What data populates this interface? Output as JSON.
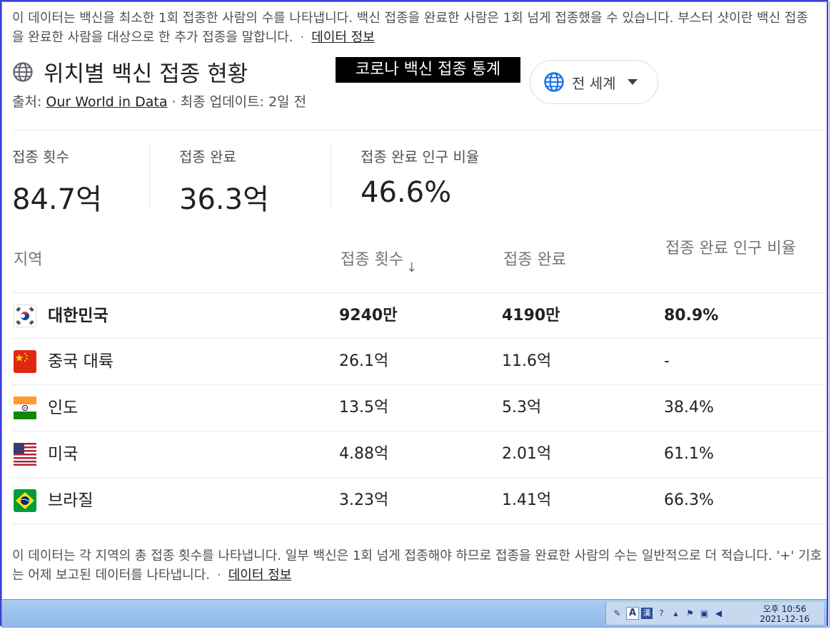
{
  "intro_text": "이 데이터는 백신을 최소한 1회 접종한 사람의 수를 나타냅니다. 백신 접종을 완료한 사람은 1회 넘게 접종했을 수 있습니다. 부스터 샷이란 백신 접종을 완료한 사람을 대상으로 한 추가 접종을 말합니다.",
  "intro_link": "데이터 정보",
  "title": "위치별 백신 접종 현황",
  "banner": "코로나 백신 접종 통계",
  "region_selector": "전 세계",
  "source_label": "출처: ",
  "source_link": "Our World in Data",
  "updated": "· 최종 업데이트: 2일 전",
  "stats": [
    {
      "label": "접종 횟수",
      "value": "84.7억"
    },
    {
      "label": "접종 완료",
      "value": "36.3억"
    },
    {
      "label": "접종 완료 인구 비율",
      "value": "46.6%"
    }
  ],
  "table": {
    "headers": [
      "지역",
      "접종 횟수",
      "접종 완료",
      "접종 완료 인구 비율"
    ],
    "sort_icon": "arrow-down-icon",
    "rows": [
      {
        "flag": "south-korea-flag-icon",
        "region": "대한민국",
        "doses": "9240만",
        "completed": "4190만",
        "percent": "80.9%"
      },
      {
        "flag": "china-flag-icon",
        "region": "중국 대륙",
        "doses": "26.1억",
        "completed": "11.6억",
        "percent": "-"
      },
      {
        "flag": "india-flag-icon",
        "region": "인도",
        "doses": "13.5억",
        "completed": "5.3억",
        "percent": "38.4%"
      },
      {
        "flag": "usa-flag-icon",
        "region": "미국",
        "doses": "4.88억",
        "completed": "2.01억",
        "percent": "61.1%"
      },
      {
        "flag": "brazil-flag-icon",
        "region": "브라질",
        "doses": "3.23억",
        "completed": "1.41억",
        "percent": "66.3%"
      }
    ]
  },
  "footnote_text": "이 데이터는 각 지역의 총 접종 횟수를 나타냅니다. 일부 백신은 1회 넘게 접종해야 하므로 접종을 완료한 사람의 수는 일반적으로 더 적습니다. '+' 기호는 어제 보고된 데이터를 나타냅니다.",
  "footnote_link": "데이터 정보",
  "taskbar": {
    "ime_a": "A",
    "ime_hanja": "漢",
    "time": "오후 10:56",
    "date": "2021-12-16"
  },
  "colors": {
    "accent_blue": "#1a73e8",
    "frame": "#3b3fd6"
  }
}
